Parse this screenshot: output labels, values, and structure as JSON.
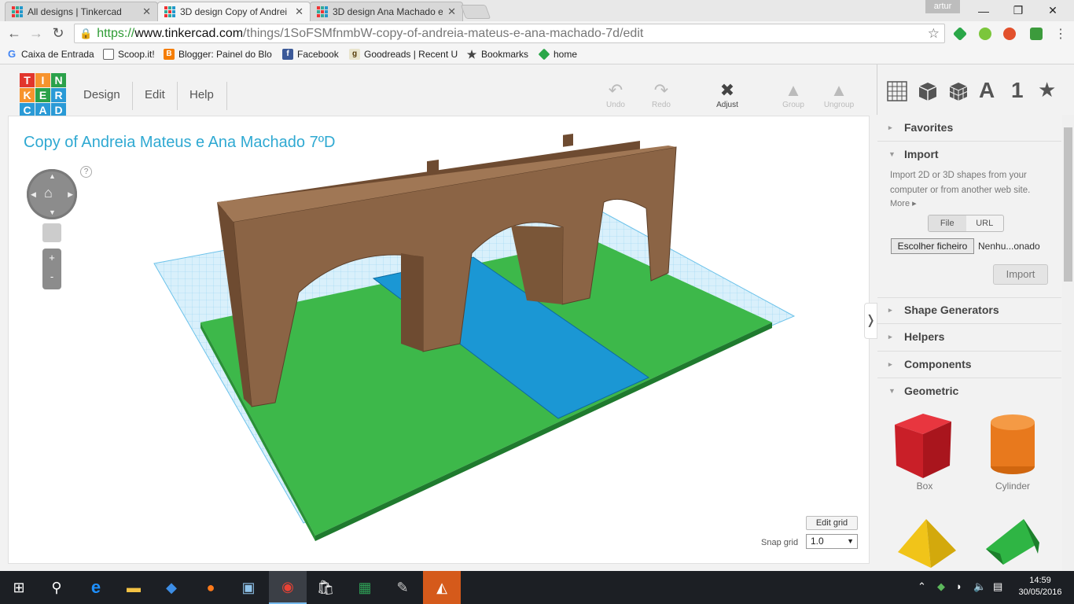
{
  "browser": {
    "tabs": [
      {
        "title": "All designs | Tinkercad",
        "active": false
      },
      {
        "title": "3D design Copy of Andrei",
        "active": true
      },
      {
        "title": "3D design Ana Machado e",
        "active": false
      }
    ],
    "user": "artur",
    "url_scheme": "https://",
    "url_host": "www.tinkercad.com",
    "url_path": "/things/1SoFSMfnmbW-copy-of-andreia-mateus-e-ana-machado-7d/edit",
    "bookmarks": [
      {
        "label": "Caixa de Entrada",
        "icon": "google-g-icon"
      },
      {
        "label": "Scoop.it!",
        "icon": "page-icon"
      },
      {
        "label": "Blogger: Painel do Blo",
        "icon": "blogger-icon"
      },
      {
        "label": "Facebook",
        "icon": "facebook-icon"
      },
      {
        "label": "Goodreads | Recent U",
        "icon": "goodreads-icon"
      },
      {
        "label": "Bookmarks",
        "icon": "star-icon"
      },
      {
        "label": "home",
        "icon": "feedly-icon"
      }
    ]
  },
  "app": {
    "logo_letters": [
      "T",
      "I",
      "N",
      "K",
      "E",
      "R",
      "C",
      "A",
      "D"
    ],
    "menu": [
      "Design",
      "Edit",
      "Help"
    ],
    "tools": {
      "undo": "Undo",
      "redo": "Redo",
      "adjust": "Adjust",
      "group": "Group",
      "ungroup": "Ungroup"
    },
    "design_title": "Copy of Andreia Mateus e Ana Machado 7ºD"
  },
  "panel": {
    "top_icons": [
      "grid-icon",
      "cube-icon",
      "mesh-cube-icon",
      "text-A-icon",
      "number-1-icon",
      "star-icon"
    ],
    "top_text": {
      "letter": "A",
      "number": "1"
    },
    "sections": {
      "favorites": "Favorites",
      "import": "Import",
      "shape_generators": "Shape Generators",
      "helpers": "Helpers",
      "components": "Components",
      "geometric": "Geometric"
    },
    "import_desc": "Import 2D or 3D shapes from your computer or from another web site.",
    "import_more": "More ▸",
    "file_tab": "File",
    "url_tab": "URL",
    "choose_file": "Escolher ficheiro",
    "no_file": "Nenhu...onado",
    "import_button": "Import",
    "shapes": [
      {
        "label": "Box",
        "color": "#d9262f"
      },
      {
        "label": "Cylinder",
        "color": "#e8791d"
      },
      {
        "label": "",
        "color": "#f1c419"
      },
      {
        "label": "",
        "color": "#26a236"
      }
    ]
  },
  "workplane": {
    "edit_grid": "Edit grid",
    "snap_label": "Snap grid",
    "snap_value": "1.0",
    "help": "?"
  },
  "taskbar": {
    "time": "14:59",
    "date": "30/05/2016"
  },
  "colors": {
    "brand_cyan": "#2fa9d2",
    "ground_green": "#3db84a",
    "bridge_brown": "#8b6445",
    "water_blue": "#1b97d4",
    "grid_blue": "#a9dcf4"
  }
}
